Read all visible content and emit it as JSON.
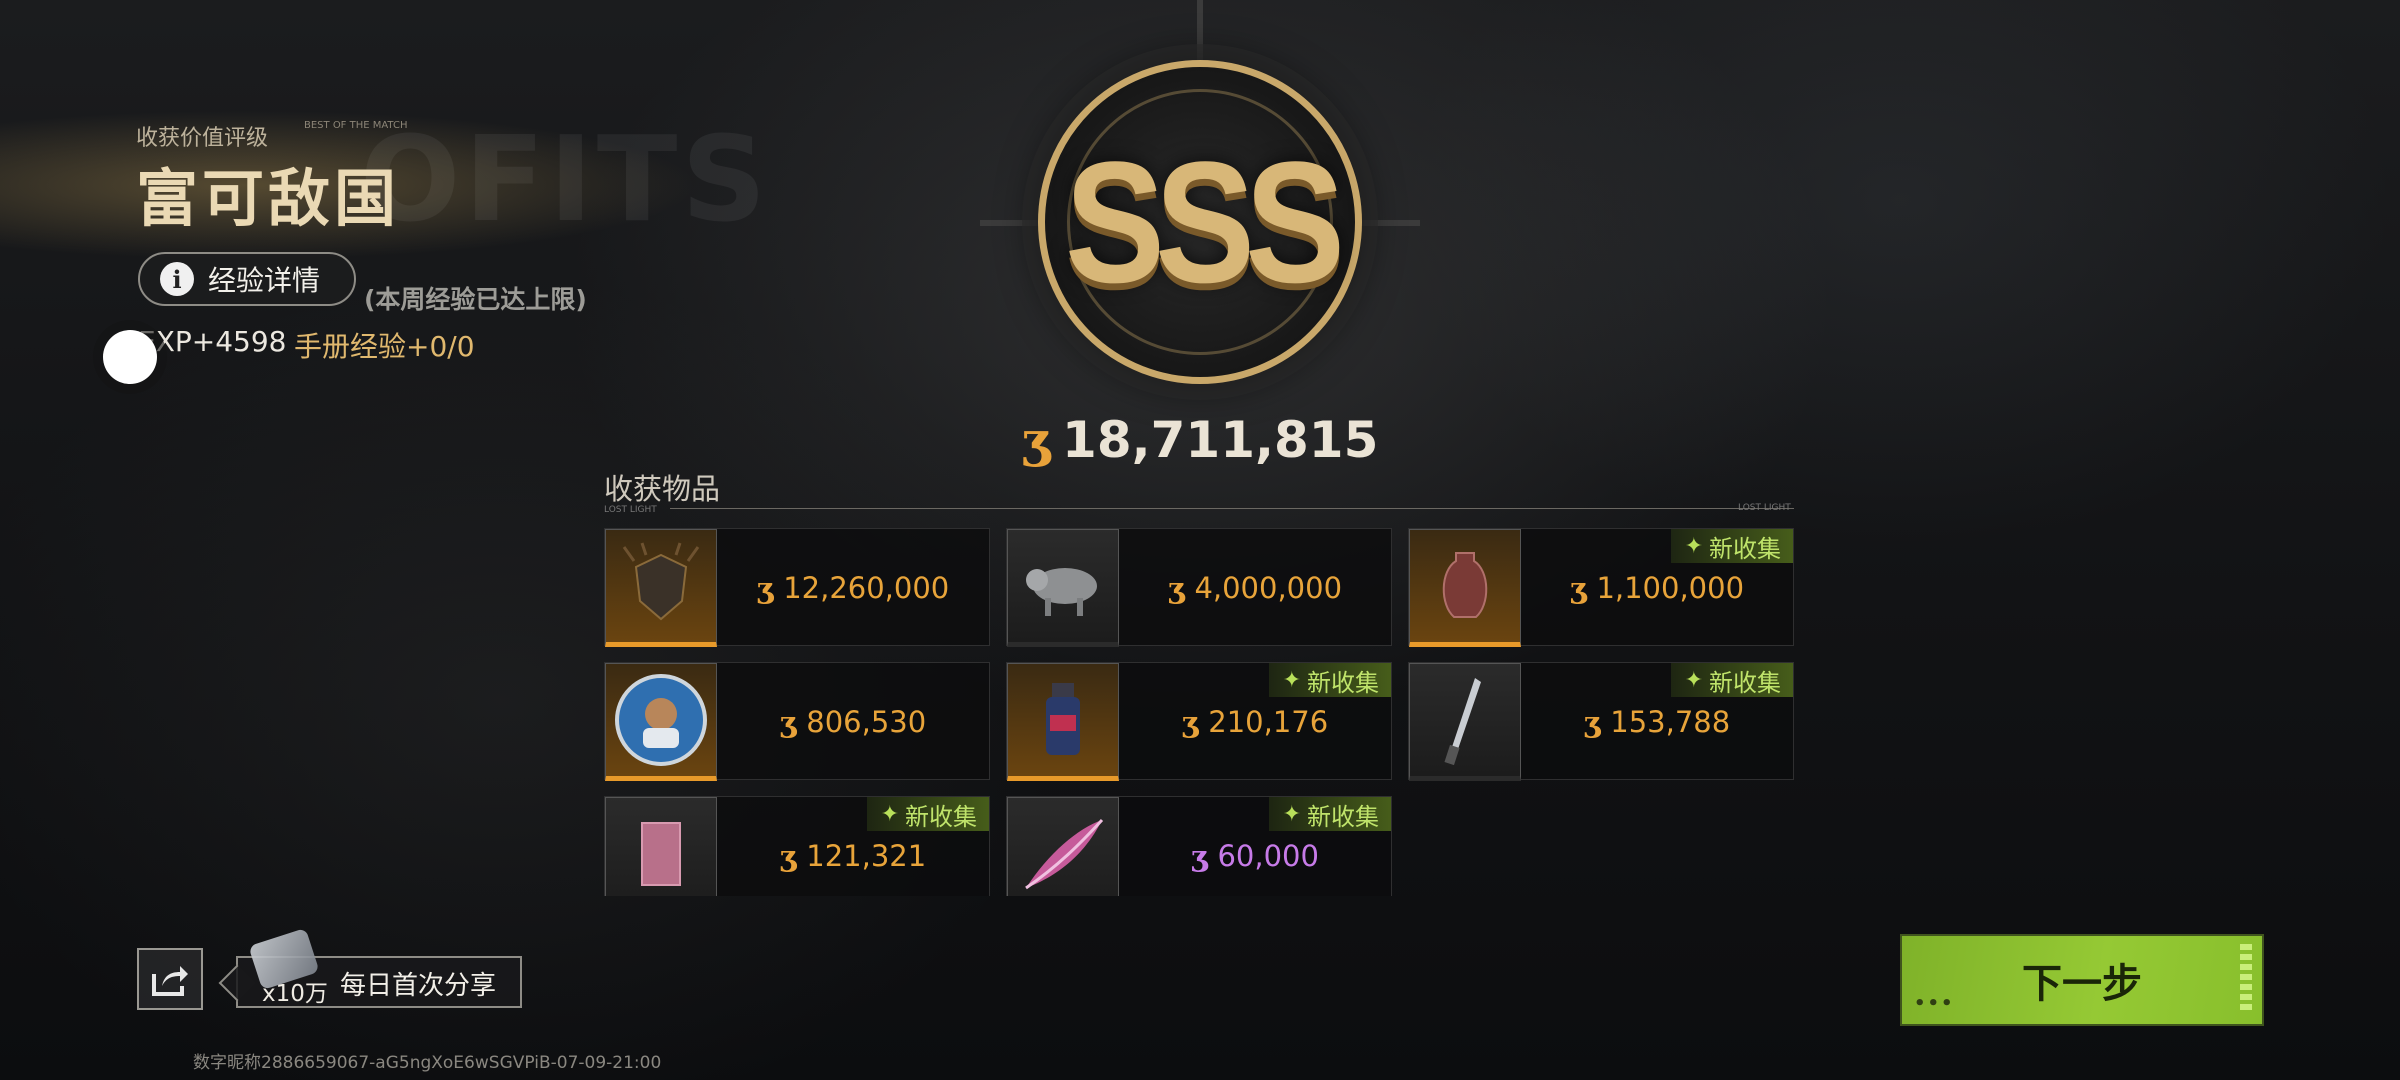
{
  "rating": {
    "caption": "收获价值评级",
    "best_tag": "BEST OF THE MATCH",
    "title": "富可敌国",
    "watermark": "OFITS",
    "grade": "SSS"
  },
  "experience": {
    "details_button": "经验详情",
    "week_limit_note": "(本周经验已达上限)",
    "exp_gain": "EXP+4598",
    "manual_exp": "手册经验+0/0"
  },
  "total_value": "18,711,815",
  "currency_symbol": "ʒ",
  "items_section": {
    "title": "收获物品",
    "line_label_left": "LOST LIGHT",
    "line_label_right": "LOST LIGHT",
    "new_badge": "新收集",
    "items": [
      {
        "value": "12,260,000",
        "rarity": "gold",
        "new": false,
        "icon": "ornate-shield-icon"
      },
      {
        "value": "4,000,000",
        "rarity": "plain",
        "new": false,
        "icon": "pig-statue-icon"
      },
      {
        "value": "1,100,000",
        "rarity": "gold",
        "new": true,
        "icon": "vase-icon"
      },
      {
        "value": "806,530",
        "rarity": "gold",
        "new": false,
        "icon": "medallion-icon"
      },
      {
        "value": "210,176",
        "rarity": "gold",
        "new": true,
        "icon": "flask-icon"
      },
      {
        "value": "153,788",
        "rarity": "gold",
        "new": true,
        "icon": "knife-icon"
      },
      {
        "value": "121,321",
        "rarity": "plain",
        "new": true,
        "icon": "card-icon"
      },
      {
        "value": "60,000",
        "rarity": "purple",
        "new": true,
        "icon": "feather-icon"
      }
    ]
  },
  "share": {
    "reward": "x10万",
    "label": "每日首次分享"
  },
  "footer_id": "数字昵称2886659067-aG5ngXoE6wSGVPiB-07-09-21:00",
  "next_button": "下一步",
  "colors": {
    "gold_accent": "#e89a2a",
    "new_badge": "#bfe36a",
    "next_button": "#8fc22f",
    "purple_value": "#c77be8"
  }
}
